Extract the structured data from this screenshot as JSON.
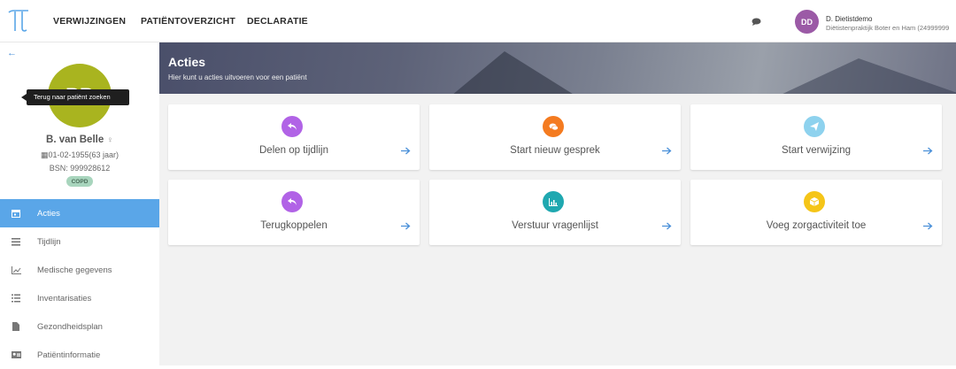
{
  "topbar": {
    "nav": [
      "VERWIJZINGEN",
      "PATIËNTOVERZICHT",
      "DECLARATIE"
    ],
    "user_initials": "DD",
    "user_name": "D. Dietistdemo",
    "user_org": "Diëtistenpraktijk Boter en Ham (24999999"
  },
  "sidebar": {
    "tooltip": "Terug naar patiënt zoeken",
    "patient_initials": "BB",
    "patient_name": "B. van Belle",
    "gender_symbol": "♀",
    "dob": "01-02-1955(63 jaar)",
    "bsn": "BSN: 999928612",
    "badge": "COPD",
    "menu": [
      {
        "label": "Acties",
        "icon": "calendar-icon",
        "active": true
      },
      {
        "label": "Tijdlijn",
        "icon": "list-icon",
        "active": false
      },
      {
        "label": "Medische gegevens",
        "icon": "line-chart-icon",
        "active": false
      },
      {
        "label": "Inventarisaties",
        "icon": "checklist-icon",
        "active": false
      },
      {
        "label": "Gezondheidsplan",
        "icon": "document-icon",
        "active": false
      },
      {
        "label": "Patiëntinformatie",
        "icon": "id-card-icon",
        "active": false
      }
    ]
  },
  "hero": {
    "title": "Acties",
    "subtitle": "Hier kunt u acties uitvoeren voor een patiënt"
  },
  "cards": [
    {
      "label": "Delen op tijdlijn",
      "icon": "share-icon",
      "color": "#b163e6"
    },
    {
      "label": "Start nieuw gesprek",
      "icon": "chat-icon",
      "color": "#f47b20"
    },
    {
      "label": "Start verwijzing",
      "icon": "send-icon",
      "color": "#8ed2ee"
    },
    {
      "label": "Terugkoppelen",
      "icon": "reply-icon",
      "color": "#b163e6"
    },
    {
      "label": "Verstuur vragenlijst",
      "icon": "bar-chart-icon",
      "color": "#1fa8b0"
    },
    {
      "label": "Voeg zorgactiviteit toe",
      "icon": "box-icon",
      "color": "#f5c518"
    }
  ]
}
